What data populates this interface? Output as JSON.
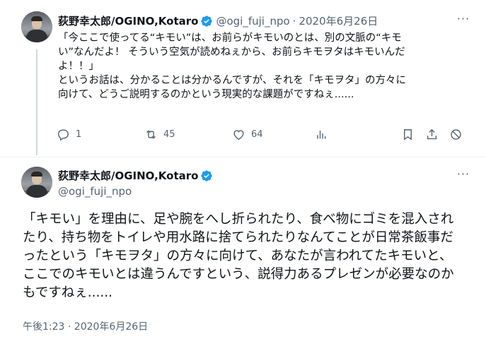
{
  "tweet1": {
    "display_name": "荻野幸太郎/OGINO,Kotaro",
    "handle": "@ogi_fuji_npo",
    "separator": "·",
    "date": "2020年6月26日",
    "more_label": "···",
    "body_lines": [
      "「今ここで使ってる“キモい”は、お前らがキモいのとは、別の文脈の“キモ",
      "い”なんだよ！ そういう空気が読めねぇから、お前らキモヲタはキモいんだ",
      "よ！！」",
      "というお話は、分かることは分かるんですが、それを「キモヲタ」の方々に",
      "向けて、どうご説明するのかという現実的な課題がですねぇ......"
    ],
    "actions": {
      "reply_count": "1",
      "retweet_count": "45",
      "like_count": "64"
    }
  },
  "tweet2": {
    "display_name": "荻野幸太郎/OGINO,Kotaro",
    "handle": "@ogi_fuji_npo",
    "more_label": "···",
    "body_lines": [
      "「キモい」を理由に、足や腕をへし折られたり、食べ物にゴミを混入され",
      "たり、持ち物をトイレや用水路に捨てられたりなんてことが日常茶飯事だ",
      "ったという「キモヲタ」の方々に向けて、あなたが言われてたキモいと、",
      "ここでのキモいとは違うんですという、説得力あるプレゼンが必要なのか",
      "もですねぇ......"
    ],
    "timestamp": "午後1:23 · 2020年6月26日"
  },
  "colors": {
    "verified": "#1d9bf0",
    "secondary_text": "#536471",
    "thread_line": "#cfd9de"
  },
  "icons": [
    "verified-badge-icon",
    "more-icon",
    "reply-icon",
    "retweet-icon",
    "like-icon",
    "views-icon",
    "bookmark-icon",
    "share-icon",
    "block-icon"
  ]
}
